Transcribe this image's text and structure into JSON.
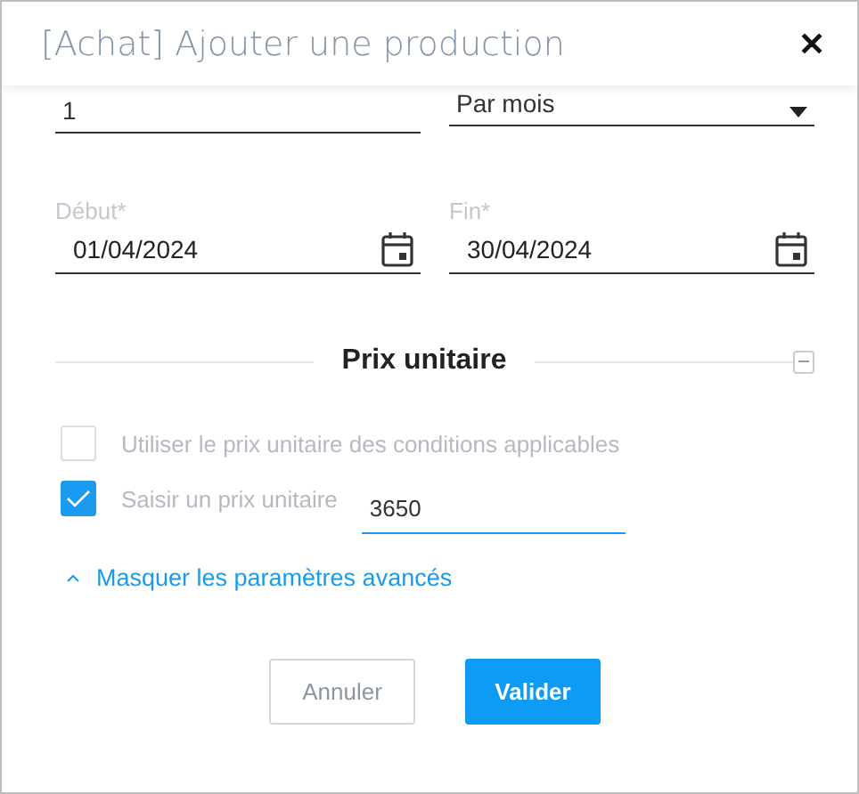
{
  "window": {
    "title": "[Achat] Ajouter une production",
    "close": "✕"
  },
  "top_fields": [
    {
      "kind": "text",
      "value": "1"
    },
    {
      "kind": "select",
      "value": "Par mois"
    }
  ],
  "date_fields": [
    {
      "label": "Début*",
      "value": "01/04/2024"
    },
    {
      "label": "Fin*",
      "value": "30/04/2024"
    }
  ],
  "section": {
    "title": "Prix unitaire",
    "expanded": true
  },
  "options": [
    {
      "label": "Utiliser le prix unitaire des conditions applicables",
      "checked": false
    },
    {
      "label": "Saisir un prix unitaire",
      "checked": true,
      "value": "3650"
    }
  ],
  "advanced_link": "Masquer les paramètres avancés",
  "buttons": [
    {
      "label": "Annuler",
      "kind": "secondary"
    },
    {
      "label": "Valider",
      "kind": "primary"
    }
  ]
}
